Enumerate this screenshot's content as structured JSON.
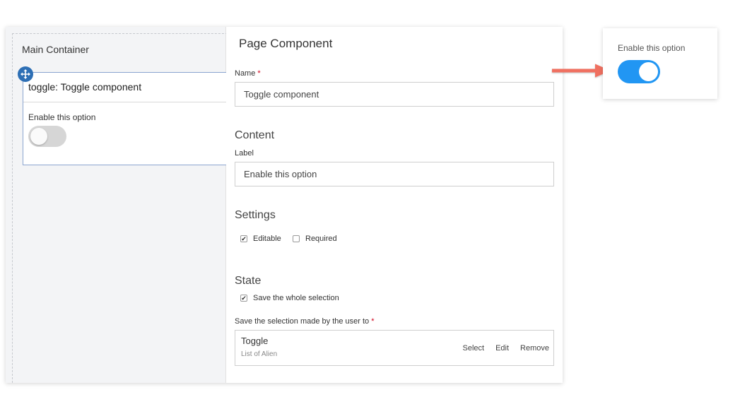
{
  "canvas": {
    "container_title": "Main Container",
    "component_header": "toggle: Toggle component",
    "component_label": "Enable this option",
    "move_icon": "move-arrows-icon"
  },
  "props": {
    "title": "Page Component",
    "name_label": "Name",
    "required_mark": "*",
    "name_value": "Toggle component",
    "content_title": "Content",
    "label_label": "Label",
    "label_value": "Enable this option",
    "settings_title": "Settings",
    "editable_label": "Editable",
    "editable_checked": true,
    "required_label": "Required",
    "required_checked": false,
    "state_title": "State",
    "save_whole_label": "Save the whole selection",
    "save_whole_checked": true,
    "save_to_label": "Save the selection made by the user to",
    "save_to_value": "Toggle",
    "save_to_sub": "List of Alien",
    "actions": {
      "select": "Select",
      "edit": "Edit",
      "remove": "Remove"
    },
    "check_mark": "✔"
  },
  "preview": {
    "label": "Enable this option",
    "toggle_on": true
  },
  "colors": {
    "accent": "#2196f3",
    "handle": "#2d6fb5",
    "arrow": "#f07060",
    "required": "#d0021b"
  }
}
